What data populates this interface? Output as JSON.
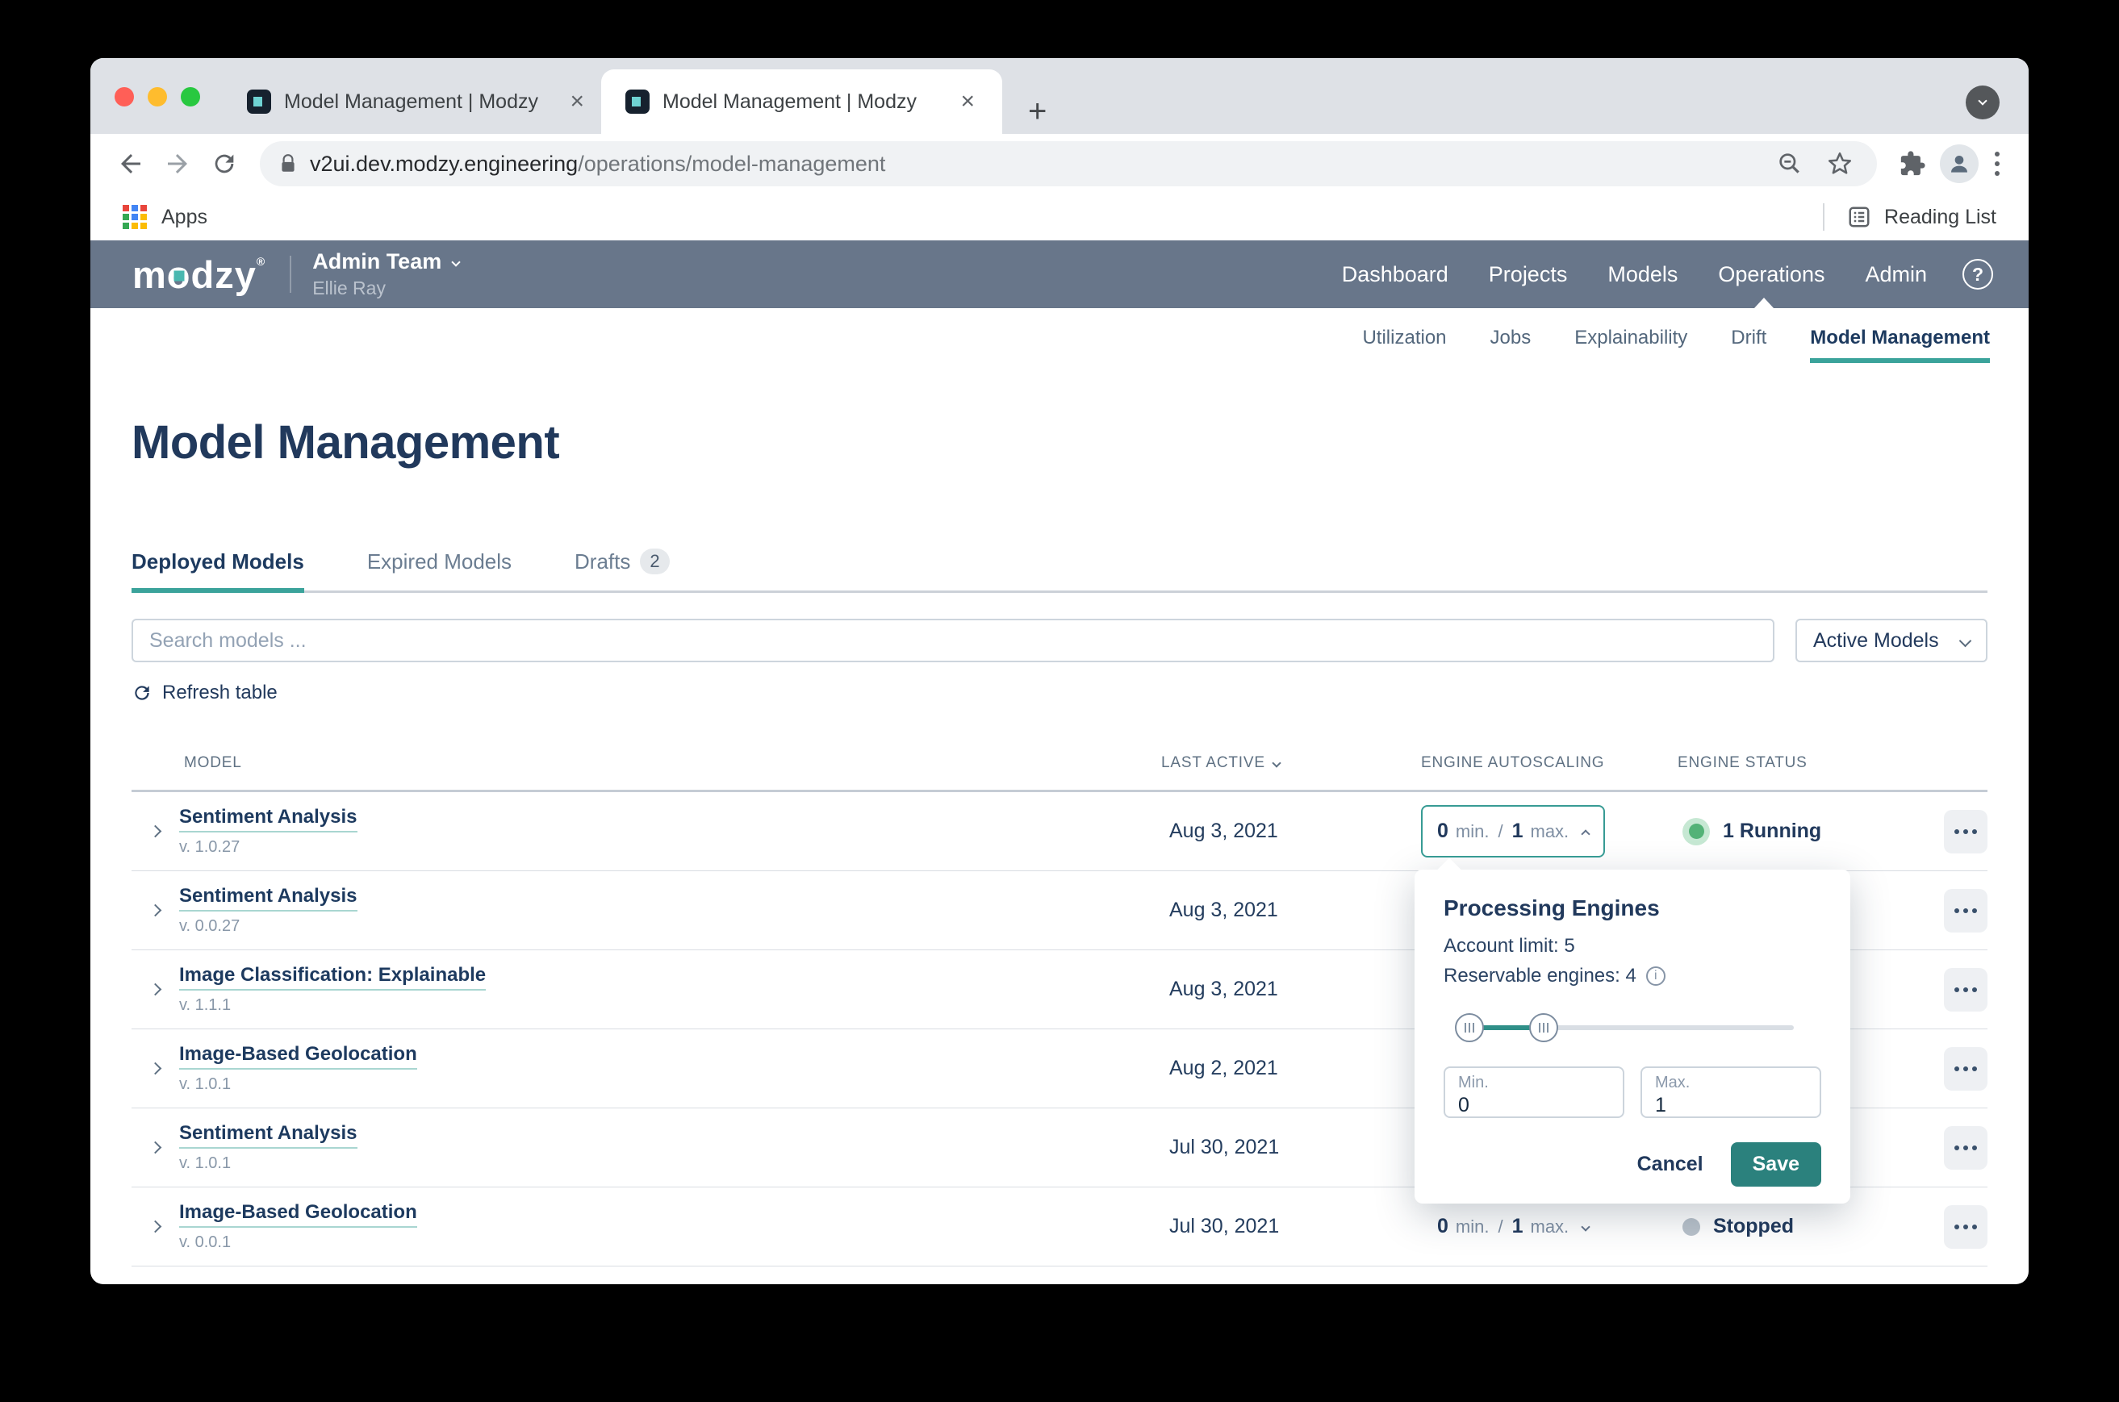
{
  "browser": {
    "tab_titles": [
      "Model Management | Modzy",
      "Model Management | Modzy"
    ],
    "url": {
      "host": "v2ui.dev.modzy.engineering",
      "path": "/operations/model-management"
    },
    "bookmarks_bar": {
      "apps": "Apps",
      "reading_list": "Reading List"
    }
  },
  "header": {
    "logo_text": "modzy",
    "team_name": "Admin Team",
    "user_name": "Ellie Ray",
    "nav": {
      "dashboard": "Dashboard",
      "projects": "Projects",
      "models": "Models",
      "operations": "Operations",
      "admin": "Admin"
    }
  },
  "subnav": {
    "utilization": "Utilization",
    "jobs": "Jobs",
    "explainability": "Explainability",
    "drift": "Drift",
    "model_management": "Model Management"
  },
  "page": {
    "title": "Model Management",
    "tabs": {
      "deployed": "Deployed Models",
      "expired": "Expired Models",
      "drafts": "Drafts",
      "drafts_badge": "2"
    },
    "search_placeholder": "Search models ...",
    "filter_value": "Active Models",
    "refresh_label": "Refresh table"
  },
  "table": {
    "headers": {
      "model": "MODEL",
      "last_active": "LAST ACTIVE",
      "autoscaling": "ENGINE AUTOSCALING",
      "status": "ENGINE STATUS"
    },
    "min_suffix": "min.",
    "max_suffix": "max.",
    "separator": "/",
    "rows": [
      {
        "name": "Sentiment Analysis",
        "version": "v. 1.0.27",
        "last_active": "Aug 3, 2021",
        "min": "0",
        "max": "1",
        "status": "1 Running"
      },
      {
        "name": "Sentiment Analysis",
        "version": "v. 0.0.27",
        "last_active": "Aug 3, 2021"
      },
      {
        "name": "Image Classification: Explainable",
        "version": "v. 1.1.1",
        "last_active": "Aug 3, 2021"
      },
      {
        "name": "Image-Based Geolocation",
        "version": "v. 1.0.1",
        "last_active": "Aug 2, 2021"
      },
      {
        "name": "Sentiment Analysis",
        "version": "v. 1.0.1",
        "last_active": "Jul 30, 2021"
      },
      {
        "name": "Image-Based Geolocation",
        "version": "v. 0.0.1",
        "last_active": "Jul 30, 2021",
        "min": "0",
        "max": "1",
        "status": "Stopped"
      }
    ]
  },
  "popover": {
    "title": "Processing Engines",
    "account_limit": "Account limit: 5",
    "reservable_engines": "Reservable engines: 4",
    "min_label": "Min.",
    "min_value": "0",
    "max_label": "Max.",
    "max_value": "1",
    "cancel": "Cancel",
    "save": "Save"
  },
  "colors": {
    "accent_teal": "#2b817d",
    "teal_underline": "#3ba39b",
    "navy": "#21395c",
    "header_slate": "#68768a",
    "running_green": "#53b277",
    "stopped_gray": "#b9c2cb"
  }
}
